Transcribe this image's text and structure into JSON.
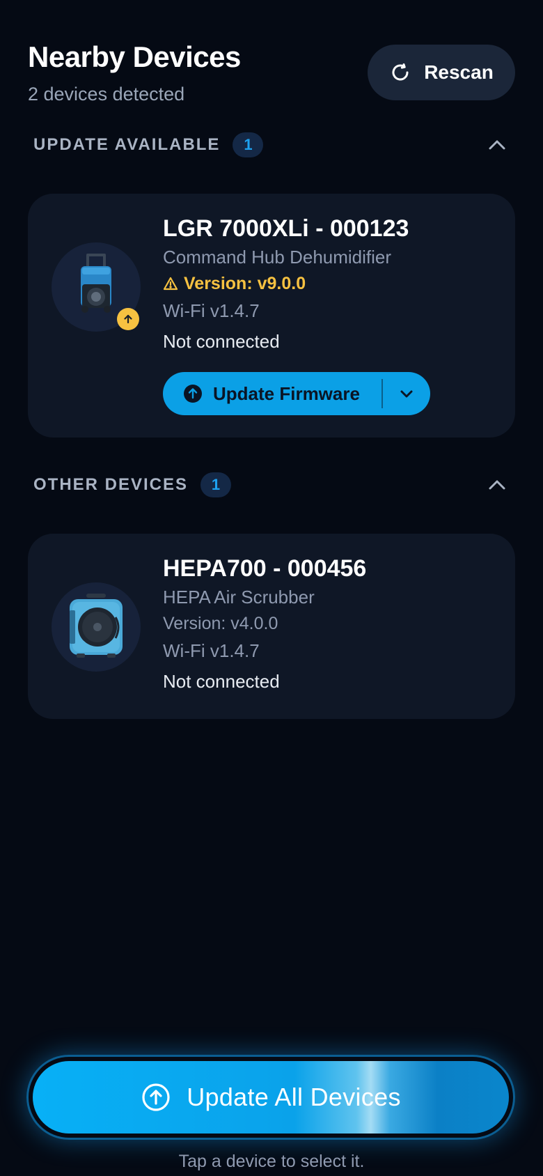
{
  "header": {
    "title": "Nearby Devices",
    "subtitle": "2 devices detected",
    "rescan_label": "Rescan",
    "rescan_icon": "refresh-icon"
  },
  "sections": {
    "update_available": {
      "label": "UPDATE AVAILABLE",
      "count": "1",
      "collapse_icon": "chevron-up-icon"
    },
    "other_devices": {
      "label": "OTHER DEVICES",
      "count": "1",
      "collapse_icon": "chevron-up-icon"
    }
  },
  "devices": [
    {
      "name": "LGR 7000XLi - 000123",
      "type": "Command Hub Dehumidifier",
      "version": "Version: v9.0.0",
      "version_warning_icon": "warning-icon",
      "wifi": "Wi-Fi v1.4.7",
      "status": "Not connected",
      "badge_icon": "update-arrow-icon",
      "action_label": "Update Firmware",
      "action_icon": "upload-circle-icon",
      "menu_icon": "chevron-down-icon"
    },
    {
      "name": "HEPA700 - 000456",
      "type": "HEPA Air Scrubber",
      "version": "Version: v4.0.0",
      "wifi": "Wi-Fi v1.4.7",
      "status": "Not connected"
    }
  ],
  "footer": {
    "cta_label": "Update All Devices",
    "cta_icon": "upload-circle-icon",
    "hint": "Tap a device to select it."
  },
  "colors": {
    "background": "#050a14",
    "card": "#0f1726",
    "accent": "#0ba0e6",
    "warning": "#f6c141",
    "muted_text": "#8f9ab0"
  }
}
